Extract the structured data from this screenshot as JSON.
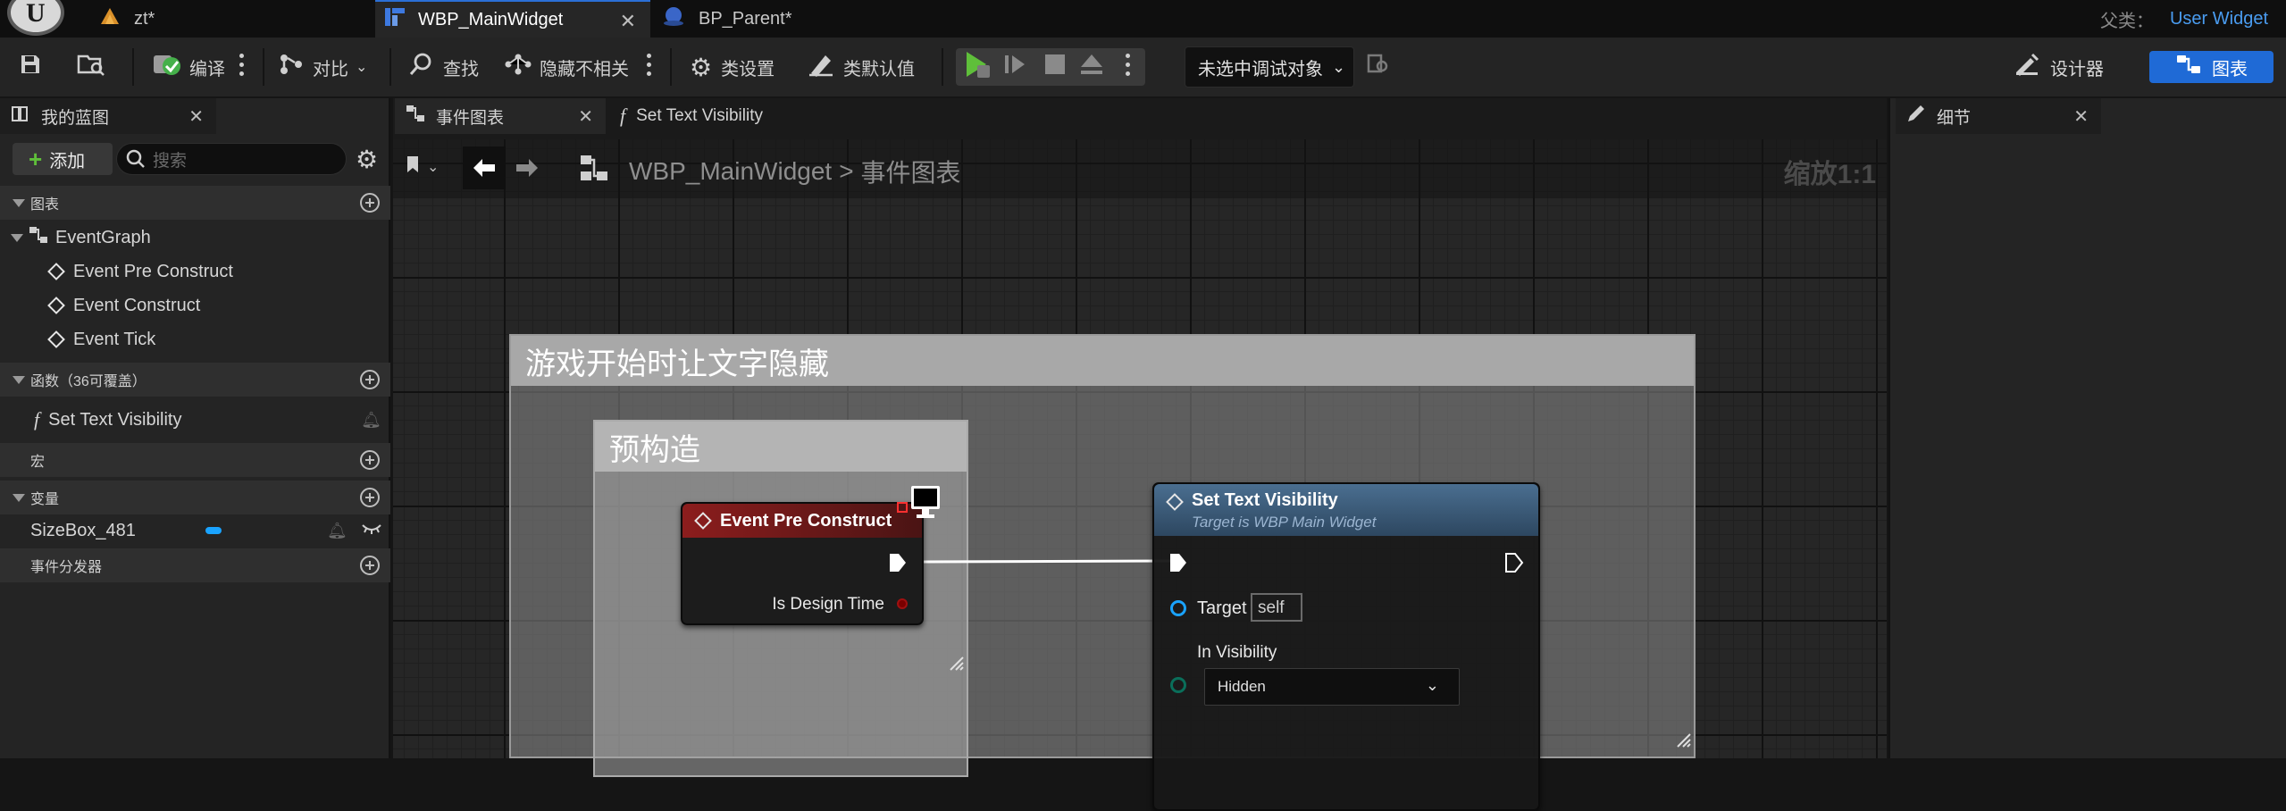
{
  "tabs": [
    {
      "label": "zt*",
      "icon": "level-icon"
    },
    {
      "label": "WBP_MainWidget",
      "icon": "widget-blueprint-icon",
      "active": true
    },
    {
      "label": "BP_Parent*",
      "icon": "blueprint-icon"
    }
  ],
  "parent_class": {
    "label": "父类：",
    "value": "User Widget"
  },
  "toolbar": {
    "compile": "编译",
    "diff": "对比",
    "find": "查找",
    "hide_unrelated": "隐藏不相关",
    "class_settings": "类设置",
    "class_defaults": "类默认值",
    "debug_object": "未选中调试对象",
    "designer": "设计器",
    "graph": "图表"
  },
  "my_blueprint": {
    "tab_label": "我的蓝图",
    "add_label": "添加",
    "search_placeholder": "搜索",
    "sections": {
      "graphs": "图表",
      "functions": "函数（36可覆盖）",
      "macros": "宏",
      "variables": "变量",
      "dispatchers": "事件分发器"
    },
    "event_graph": "EventGraph",
    "events": [
      "Event Pre Construct",
      "Event Construct",
      "Event Tick"
    ],
    "functions": [
      "Set Text Visibility"
    ],
    "variables": [
      {
        "name": "SizeBox_481",
        "color": "#1aa3ff"
      }
    ]
  },
  "graph_tabs": [
    {
      "label": "事件图表",
      "icon": "event-graph-icon",
      "active": true
    },
    {
      "label": "Set Text Visibility",
      "icon": "function-icon"
    }
  ],
  "breadcrumb": {
    "root": "WBP_MainWidget",
    "separator": ">",
    "current": "事件图表",
    "zoom": "缩放1:1"
  },
  "comments": {
    "outer": "游戏开始时让文字隐藏",
    "inner": "预构造"
  },
  "nodes": {
    "pre_construct": {
      "title": "Event Pre Construct",
      "output_pin": "Is Design Time",
      "head_color": "#8c1d1d"
    },
    "set_text_visibility": {
      "title": "Set Text Visibility",
      "subtitle": "Target is WBP Main Widget",
      "target_label": "Target",
      "target_value": "self",
      "visibility_label": "In Visibility",
      "visibility_value": "Hidden",
      "head_color": "#3b5a78"
    }
  },
  "details": {
    "tab_label": "细节"
  }
}
